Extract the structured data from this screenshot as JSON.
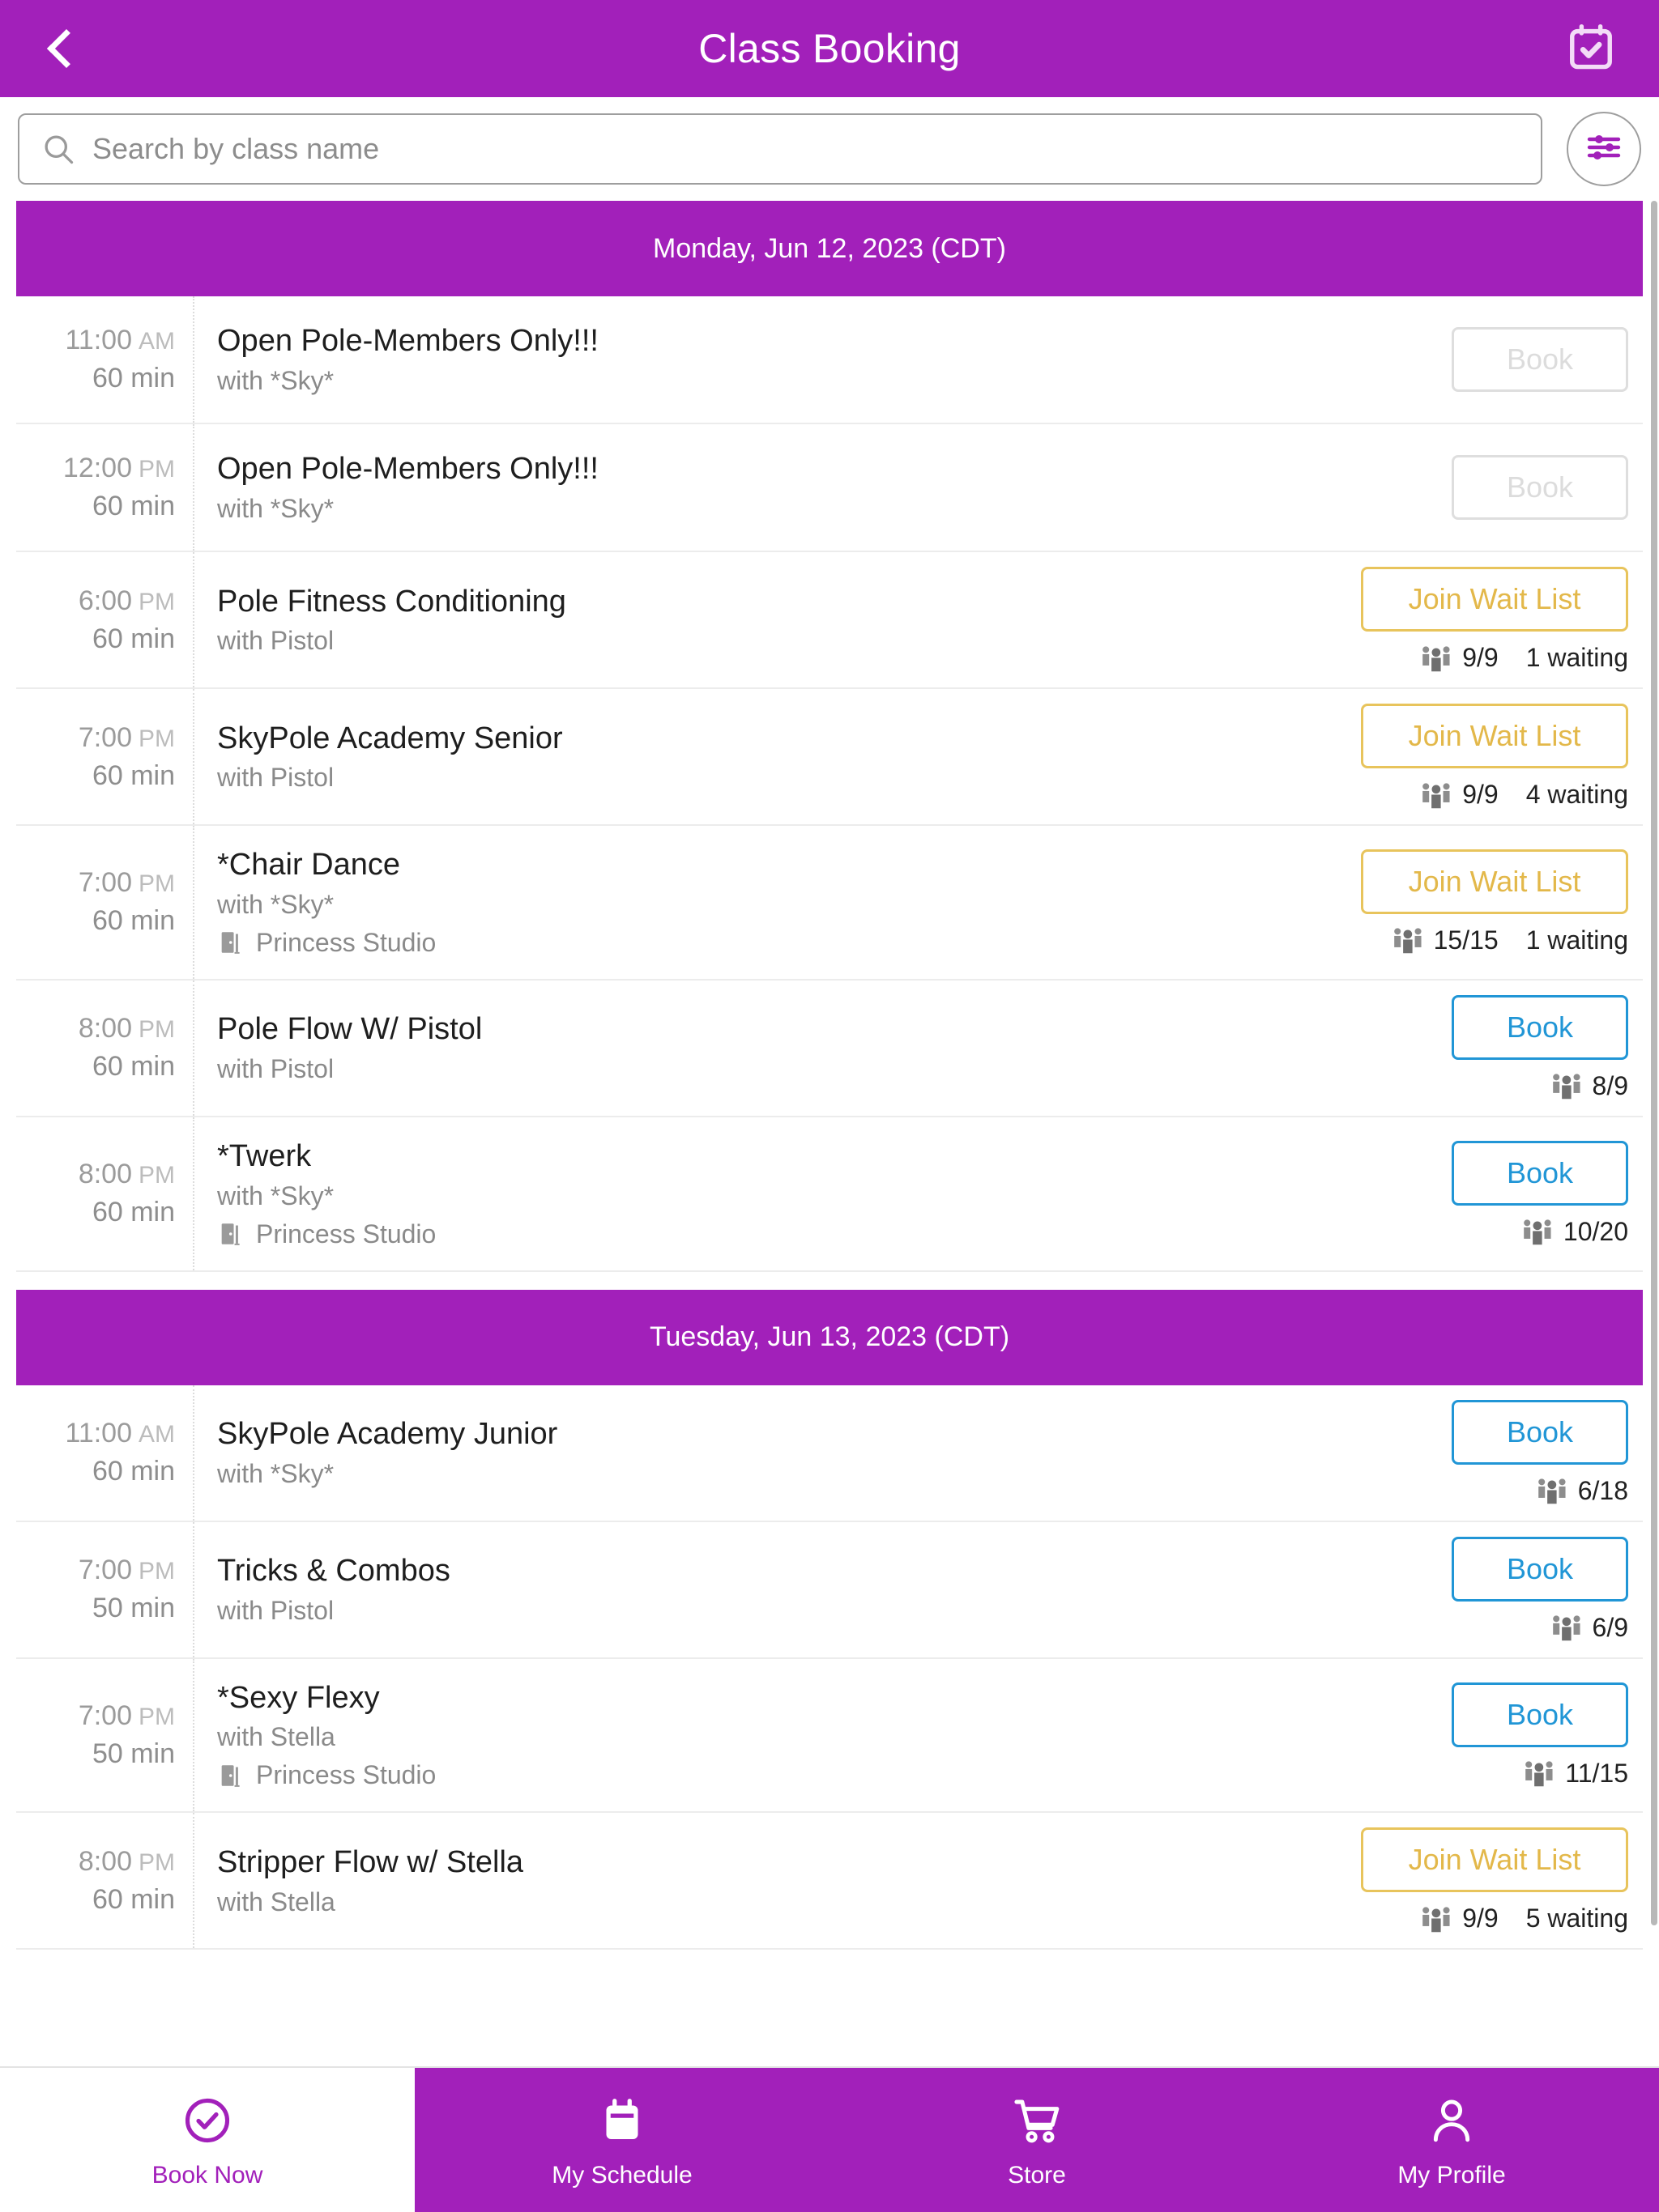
{
  "header": {
    "title": "Class Booking",
    "back_icon": "chevron-left-icon",
    "action_icon": "calendar-check-icon"
  },
  "search": {
    "placeholder": "Search by class name",
    "value": "",
    "icon": "search-icon",
    "filter_icon": "sliders-filter-icon"
  },
  "colors": {
    "brand_purple": "#A220BA",
    "book_blue": "#2196d6",
    "waitlist_gold": "#e3b84a",
    "muted_gray": "#8a8a8a"
  },
  "days": [
    {
      "label": "Monday, Jun 12, 2023 (CDT)",
      "classes": [
        {
          "time": "11:00",
          "ampm": "AM",
          "duration": "60 min",
          "name": "Open Pole-Members Only!!!",
          "teacher": "with *Sky*",
          "room": "",
          "action_label": "Book",
          "action_state": "disabled",
          "capacity": "",
          "waiting": ""
        },
        {
          "time": "12:00",
          "ampm": "PM",
          "duration": "60 min",
          "name": "Open Pole-Members Only!!!",
          "teacher": "with *Sky*",
          "room": "",
          "action_label": "Book",
          "action_state": "disabled",
          "capacity": "",
          "waiting": ""
        },
        {
          "time": "6:00",
          "ampm": "PM",
          "duration": "60 min",
          "name": "Pole Fitness Conditioning",
          "teacher": "with Pistol",
          "room": "",
          "action_label": "Join Wait List",
          "action_state": "waitlist",
          "capacity": "9/9",
          "waiting": "1 waiting"
        },
        {
          "time": "7:00",
          "ampm": "PM",
          "duration": "60 min",
          "name": "SkyPole Academy Senior",
          "teacher": "with Pistol",
          "room": "",
          "action_label": "Join Wait List",
          "action_state": "waitlist",
          "capacity": "9/9",
          "waiting": "4 waiting"
        },
        {
          "time": "7:00",
          "ampm": "PM",
          "duration": "60 min",
          "name": "*Chair Dance",
          "teacher": "with *Sky*",
          "room": "Princess Studio",
          "action_label": "Join Wait List",
          "action_state": "waitlist",
          "capacity": "15/15",
          "waiting": "1 waiting"
        },
        {
          "time": "8:00",
          "ampm": "PM",
          "duration": "60 min",
          "name": "Pole Flow W/ Pistol",
          "teacher": "with Pistol",
          "room": "",
          "action_label": "Book",
          "action_state": "enabled",
          "capacity": "8/9",
          "waiting": ""
        },
        {
          "time": "8:00",
          "ampm": "PM",
          "duration": "60 min",
          "name": "*Twerk",
          "teacher": "with *Sky*",
          "room": "Princess Studio",
          "action_label": "Book",
          "action_state": "enabled",
          "capacity": "10/20",
          "waiting": ""
        }
      ]
    },
    {
      "label": "Tuesday, Jun 13, 2023 (CDT)",
      "classes": [
        {
          "time": "11:00",
          "ampm": "AM",
          "duration": "60 min",
          "name": "SkyPole Academy Junior",
          "teacher": "with *Sky*",
          "room": "",
          "action_label": "Book",
          "action_state": "enabled",
          "capacity": "6/18",
          "waiting": ""
        },
        {
          "time": "7:00",
          "ampm": "PM",
          "duration": "50 min",
          "name": "Tricks & Combos",
          "teacher": "with Pistol",
          "room": "",
          "action_label": "Book",
          "action_state": "enabled",
          "capacity": "6/9",
          "waiting": ""
        },
        {
          "time": "7:00",
          "ampm": "PM",
          "duration": "50 min",
          "name": "*Sexy Flexy",
          "teacher": "with Stella",
          "room": "Princess Studio",
          "action_label": "Book",
          "action_state": "enabled",
          "capacity": "11/15",
          "waiting": ""
        },
        {
          "time": "8:00",
          "ampm": "PM",
          "duration": "60 min",
          "name": "Stripper Flow w/ Stella",
          "teacher": "with Stella",
          "room": "",
          "action_label": "Join Wait List",
          "action_state": "waitlist",
          "capacity": "9/9",
          "waiting": "5 waiting"
        }
      ]
    }
  ],
  "bottom_nav": [
    {
      "label": "Book Now",
      "icon": "check-circle-icon",
      "active": true
    },
    {
      "label": "My Schedule",
      "icon": "calendar-icon",
      "active": false
    },
    {
      "label": "Store",
      "icon": "shopping-cart-icon",
      "active": false
    },
    {
      "label": "My Profile",
      "icon": "person-icon",
      "active": false
    }
  ]
}
